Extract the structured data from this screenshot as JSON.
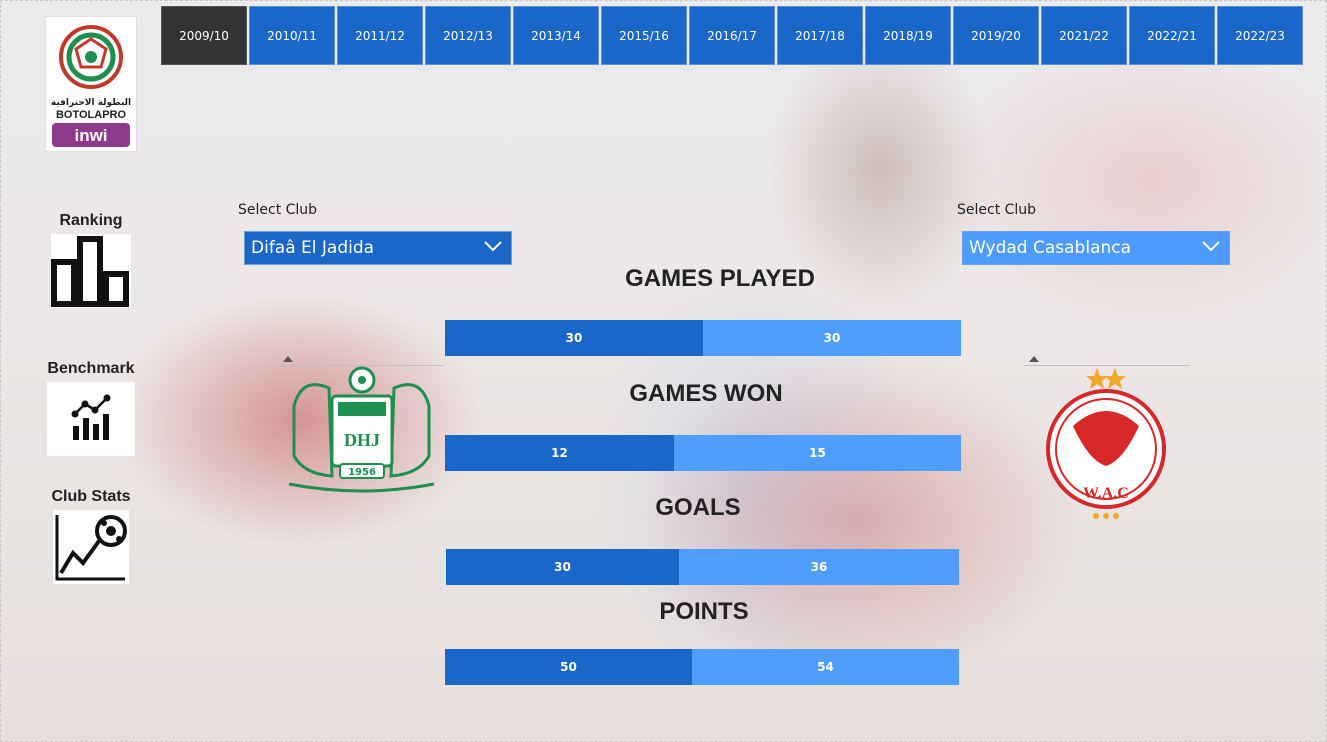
{
  "seasons": [
    "2009/10",
    "2010/11",
    "2011/12",
    "2012/13",
    "2013/14",
    "2015/16",
    "2016/17",
    "2017/18",
    "2018/19",
    "2019/20",
    "2021/22",
    "2022/21",
    "2022/23"
  ],
  "active_season": "2009/10",
  "logo": {
    "arabic": "البطولة الاحترافية",
    "brand": "BOTOLAPRO",
    "sponsor": "inwi"
  },
  "nav": {
    "ranking": "Ranking",
    "benchmark": "Benchmark",
    "club_stats": "Club Stats"
  },
  "left": {
    "select_label": "Select Club",
    "club": "Difaâ El Jadida",
    "crest_year": "1956",
    "crest_letters": "DHJ"
  },
  "right": {
    "select_label": "Select Club",
    "club": "Wydad Casablanca",
    "crest_letters": "W.A.C"
  },
  "metrics": [
    {
      "title": "GAMES PLAYED",
      "left": "30",
      "right": "30",
      "left_value": 30,
      "right_value": 30
    },
    {
      "title": "GAMES WON",
      "left": "12",
      "right": "15",
      "left_value": 12,
      "right_value": 15
    },
    {
      "title": "GOALS",
      "left": "30",
      "right": "36",
      "left_value": 30,
      "right_value": 36
    },
    {
      "title": "POINTS",
      "left": "50",
      "right": "54",
      "left_value": 50,
      "right_value": 54
    }
  ],
  "colors": {
    "accent_dark": "#1a66c9",
    "accent_light": "#4f9dfc",
    "active": "#333333"
  }
}
